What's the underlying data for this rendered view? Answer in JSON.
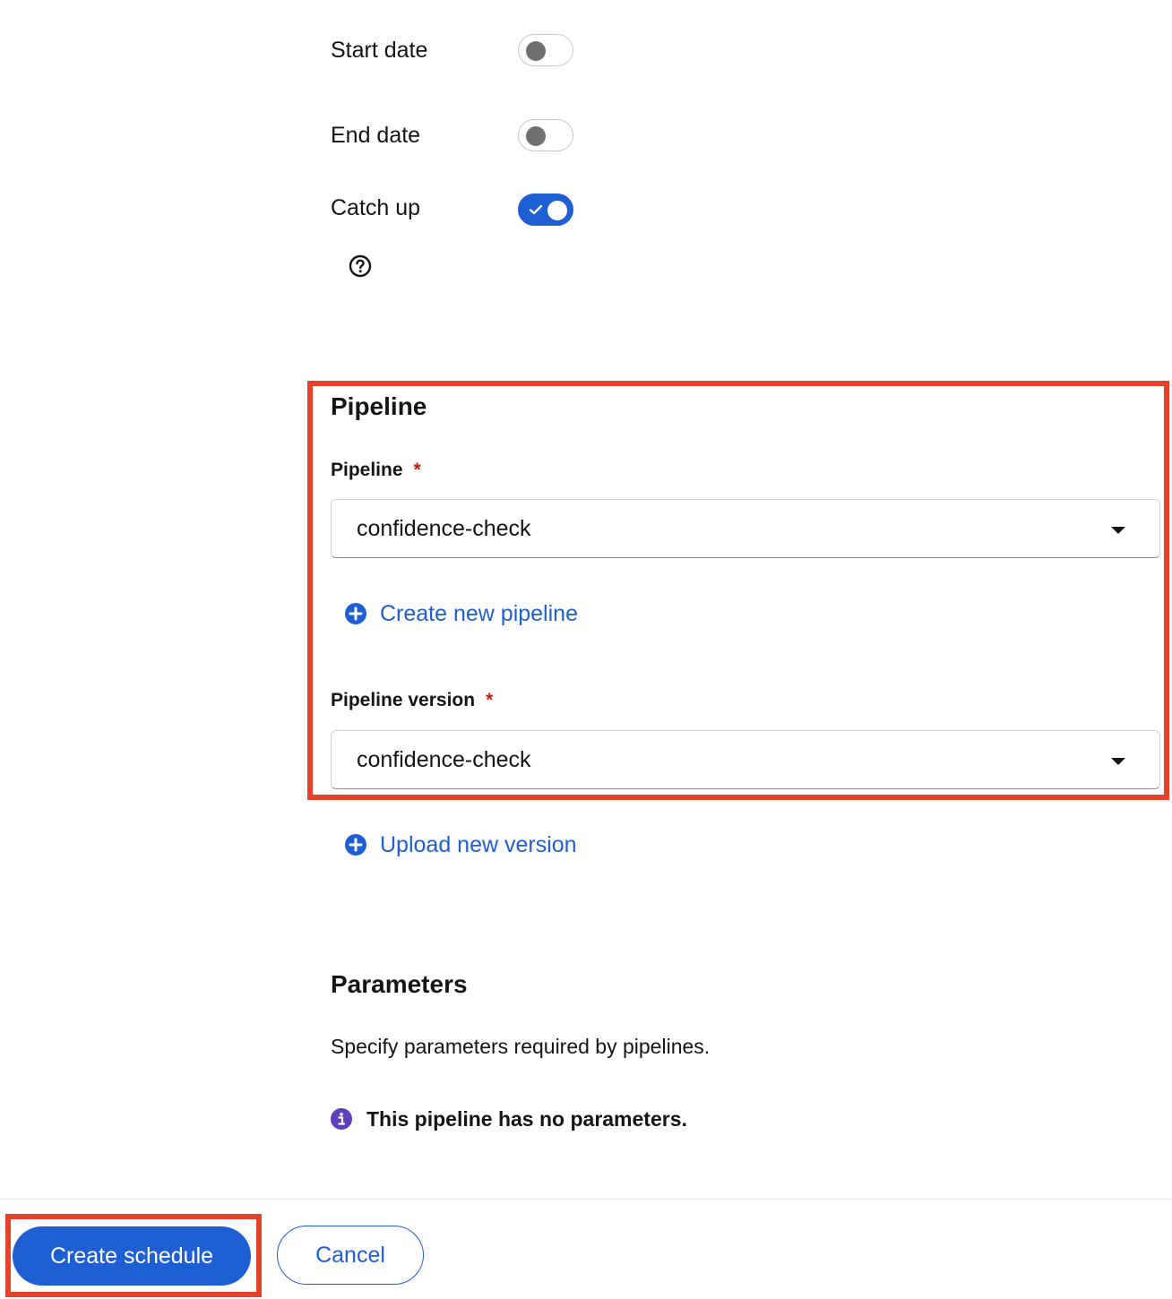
{
  "toggles": {
    "start_date": {
      "label": "Start date",
      "on": false
    },
    "end_date": {
      "label": "End date",
      "on": false
    },
    "catch_up": {
      "label": "Catch up",
      "on": true
    }
  },
  "pipeline_section": {
    "title": "Pipeline",
    "pipeline_field": {
      "label": "Pipeline",
      "required_mark": "*",
      "value": "confidence-check"
    },
    "create_pipeline_label": "Create new pipeline",
    "version_field": {
      "label": "Pipeline version",
      "required_mark": "*",
      "value": "confidence-check"
    },
    "upload_version_label": "Upload new version"
  },
  "parameters_section": {
    "title": "Parameters",
    "description": "Specify parameters required by pipelines.",
    "info_text": "This pipeline has no parameters."
  },
  "footer": {
    "create_label": "Create schedule",
    "cancel_label": "Cancel"
  },
  "colors": {
    "accent": "#1e5fd3",
    "highlight": "#e8412a",
    "required": "#c9190b",
    "info": "#5e40be"
  },
  "icons": {
    "help": "question-circle-icon",
    "add": "plus-circle-icon",
    "info": "info-circle-icon",
    "dropdown": "caret-down-icon"
  }
}
